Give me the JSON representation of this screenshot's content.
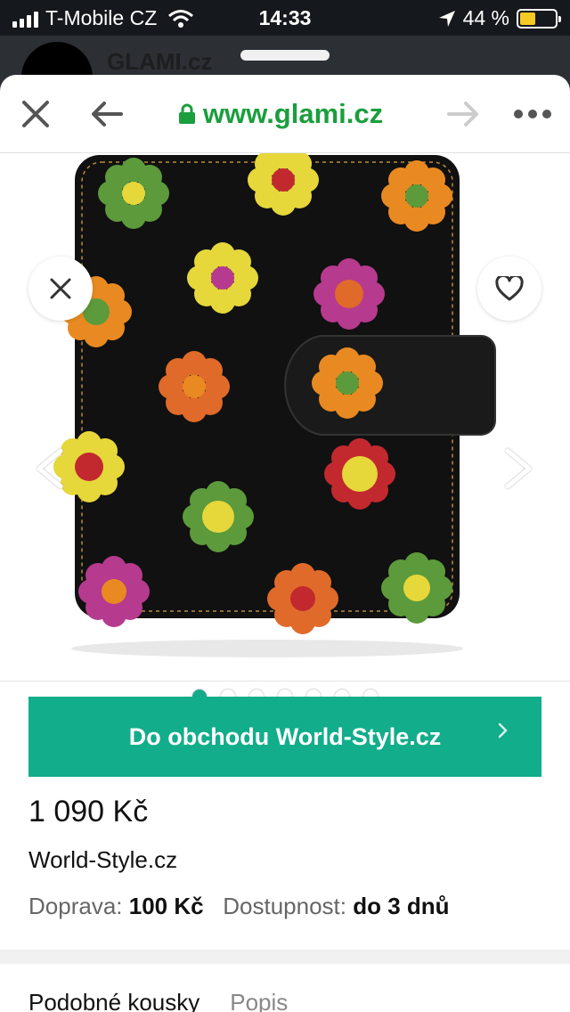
{
  "status": {
    "carrier": "T-Mobile CZ",
    "time": "14:33",
    "battery": "44 %",
    "battery_level": 0.44
  },
  "background_app": {
    "name": "GLAMI.cz"
  },
  "browser": {
    "url": "www.glami.cz"
  },
  "gallery": {
    "image_count": 7,
    "active_index": 0
  },
  "product": {
    "cta": "Do obchodu World-Style.cz",
    "price": "1 090 Kč",
    "shop": "World-Style.cz",
    "shipping_label": "Doprava:",
    "shipping_value": "100 Kč",
    "availability_label": "Dostupnost:",
    "availability_value": "do 3 dnů"
  },
  "tabs": [
    "Podobné kousky",
    "Popis"
  ],
  "colors": {
    "accent": "#12ad8b",
    "url_green": "#1b9e3e"
  }
}
